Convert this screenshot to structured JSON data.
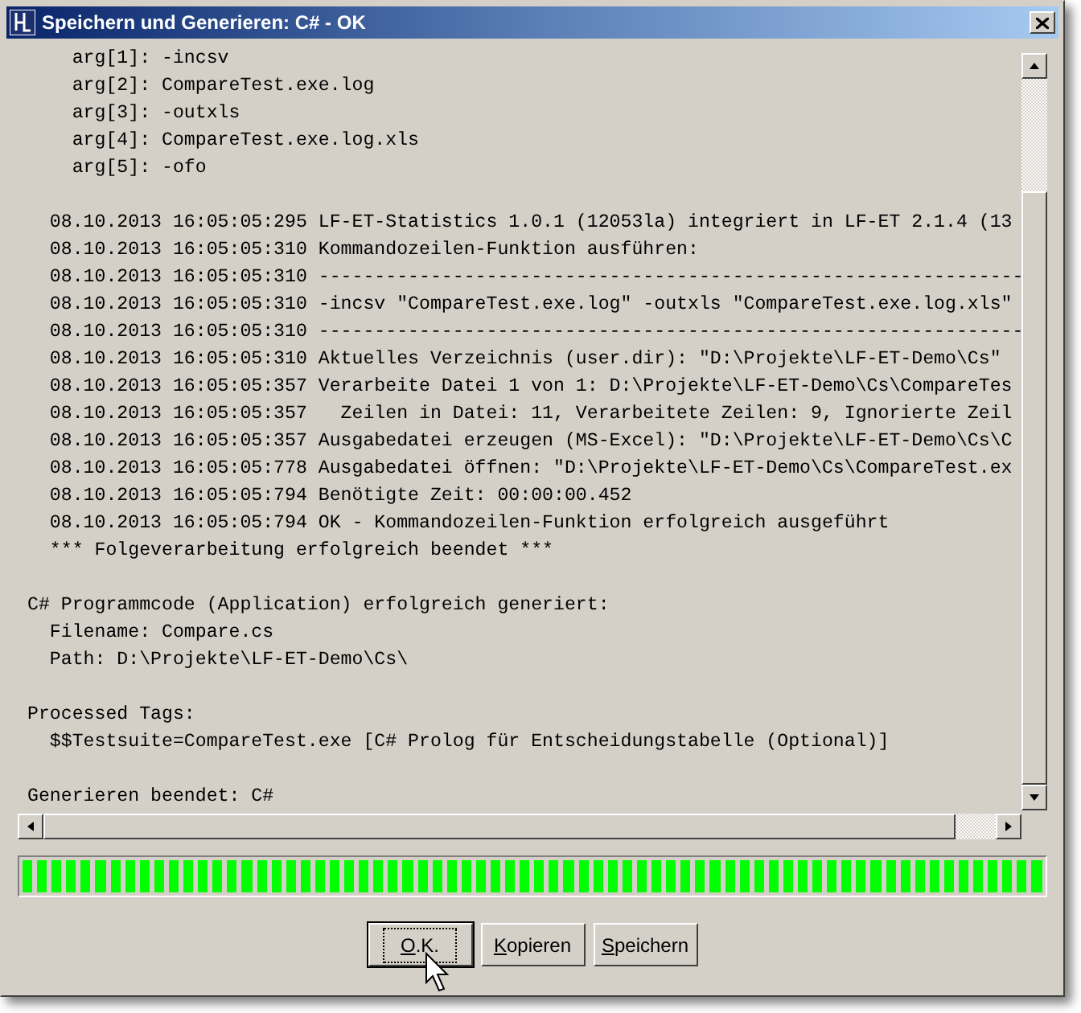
{
  "window": {
    "title": "Speichern und Generieren: C# - OK"
  },
  "log_blocks": [
    {
      "lines": [
        "    arg[1]: -incsv",
        "    arg[2]: CompareTest.exe.log",
        "    arg[3]: -outxls",
        "    arg[4]: CompareTest.exe.log.xls",
        "    arg[5]: -ofo"
      ]
    },
    {
      "lines": [
        "  08.10.2013 16:05:05:295 LF-ET-Statistics 1.0.1 (12053la) integriert in LF-ET 2.1.4 (13",
        "  08.10.2013 16:05:05:310 Kommandozeilen-Funktion ausführen:",
        "  08.10.2013 16:05:05:310 ---------------------------------------------------------------",
        "  08.10.2013 16:05:05:310 -incsv \"CompareTest.exe.log\" -outxls \"CompareTest.exe.log.xls\"",
        "  08.10.2013 16:05:05:310 ---------------------------------------------------------------",
        "  08.10.2013 16:05:05:310 Aktuelles Verzeichnis (user.dir): \"D:\\Projekte\\LF-ET-Demo\\Cs\"",
        "  08.10.2013 16:05:05:357 Verarbeite Datei 1 von 1: D:\\Projekte\\LF-ET-Demo\\Cs\\CompareTes",
        "  08.10.2013 16:05:05:357   Zeilen in Datei: 11, Verarbeitete Zeilen: 9, Ignorierte Zeil",
        "  08.10.2013 16:05:05:357 Ausgabedatei erzeugen (MS-Excel): \"D:\\Projekte\\LF-ET-Demo\\Cs\\C",
        "  08.10.2013 16:05:05:778 Ausgabedatei öffnen: \"D:\\Projekte\\LF-ET-Demo\\Cs\\CompareTest.ex",
        "  08.10.2013 16:05:05:794 Benötigte Zeit: 00:00:00.452",
        "  08.10.2013 16:05:05:794 OK - Kommandozeilen-Funktion erfolgreich ausgeführt",
        "  *** Folgeverarbeitung erfolgreich beendet ***"
      ]
    },
    {
      "lines": [
        "C# Programmcode (Application) erfolgreich generiert:",
        "  Filename: Compare.cs",
        "  Path: D:\\Projekte\\LF-ET-Demo\\Cs\\"
      ]
    },
    {
      "lines": [
        "Processed Tags:",
        "  $$Testsuite=CompareTest.exe [C# Prolog für Entscheidungstabelle (Optional)]"
      ]
    },
    {
      "lines": [
        "Generieren beendet: C#"
      ]
    }
  ],
  "progress": {
    "level": 1
  },
  "buttons": [
    {
      "label": "O.K.",
      "focused": true
    },
    {
      "label": "Kopieren",
      "focused": false
    },
    {
      "label": "Speichern",
      "focused": false
    }
  ]
}
